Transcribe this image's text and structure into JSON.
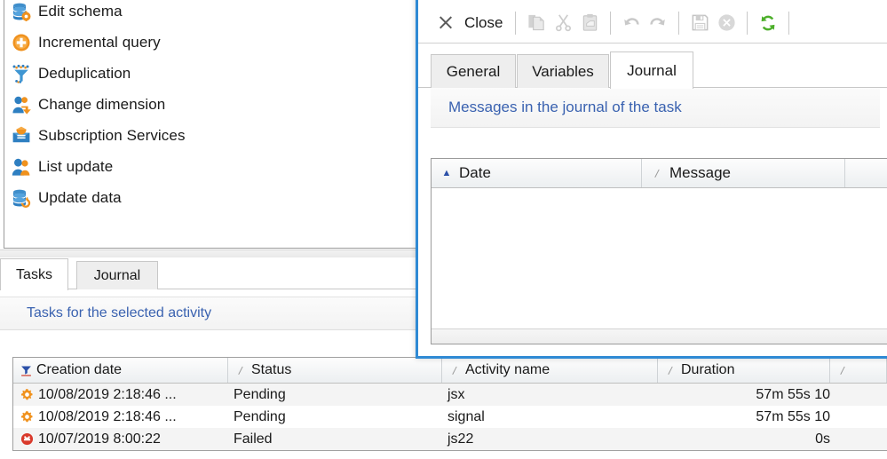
{
  "palette": {
    "items": [
      {
        "label": "Edit schema",
        "icon": "database-gear-icon"
      },
      {
        "label": "Incremental query",
        "icon": "plus-circle-icon"
      },
      {
        "label": "Deduplication",
        "icon": "funnel-icon"
      },
      {
        "label": "Change dimension",
        "icon": "person-arrow-icon"
      },
      {
        "label": "Subscription Services",
        "icon": "envelope-icon"
      },
      {
        "label": "List update",
        "icon": "people-icon"
      },
      {
        "label": "Update data",
        "icon": "database-refresh-icon"
      }
    ]
  },
  "bottom_pane": {
    "tabs": [
      {
        "label": "Tasks",
        "active": true
      },
      {
        "label": "Journal",
        "active": false
      }
    ],
    "caption": "Tasks for the selected activity",
    "table": {
      "columns": [
        {
          "label": "Creation date",
          "sort": "filter"
        },
        {
          "label": "Status",
          "sort": "none"
        },
        {
          "label": "Activity name",
          "sort": "none"
        },
        {
          "label": "Duration",
          "sort": "none"
        },
        {
          "label": "",
          "sort": "none"
        }
      ],
      "rows": [
        {
          "icon": "gear-icon",
          "creation_date": "10/08/2019 2:18:46 ...",
          "status": "Pending",
          "activity_name": "jsx",
          "duration": "57m  55s  10"
        },
        {
          "icon": "gear-icon",
          "creation_date": "10/08/2019 2:18:46 ...",
          "status": "Pending",
          "activity_name": "signal",
          "duration": "57m  55s  10"
        },
        {
          "icon": "error-icon",
          "creation_date": "10/07/2019 8:00:22",
          "status": "Failed",
          "activity_name": "js22",
          "duration": "0s"
        }
      ]
    }
  },
  "dialog": {
    "toolbar": {
      "close_label": "Close",
      "buttons": [
        {
          "name": "copy-icon",
          "enabled": false
        },
        {
          "name": "cut-icon",
          "enabled": false
        },
        {
          "name": "paste-icon",
          "enabled": false
        },
        {
          "name": "undo-icon",
          "enabled": false
        },
        {
          "name": "redo-icon",
          "enabled": false
        },
        {
          "name": "save-icon",
          "enabled": false
        },
        {
          "name": "cancel-icon",
          "enabled": false
        },
        {
          "name": "refresh-icon",
          "enabled": true
        }
      ]
    },
    "tabs": [
      {
        "label": "General",
        "active": false
      },
      {
        "label": "Variables",
        "active": false
      },
      {
        "label": "Journal",
        "active": true
      }
    ],
    "caption": "Messages in the journal of the task",
    "table": {
      "columns": [
        {
          "label": "Date",
          "sort": "asc"
        },
        {
          "label": "Message",
          "sort": "none"
        },
        {
          "label": "",
          "sort": "none"
        }
      ],
      "rows": []
    }
  },
  "colors": {
    "accent_blue": "#2f8ad4",
    "caption_text": "#3a62b0",
    "icon_orange": "#f0921e",
    "icon_blue": "#2e7fc1",
    "refresh_green": "#4caf2a",
    "error_red": "#d9392b"
  }
}
